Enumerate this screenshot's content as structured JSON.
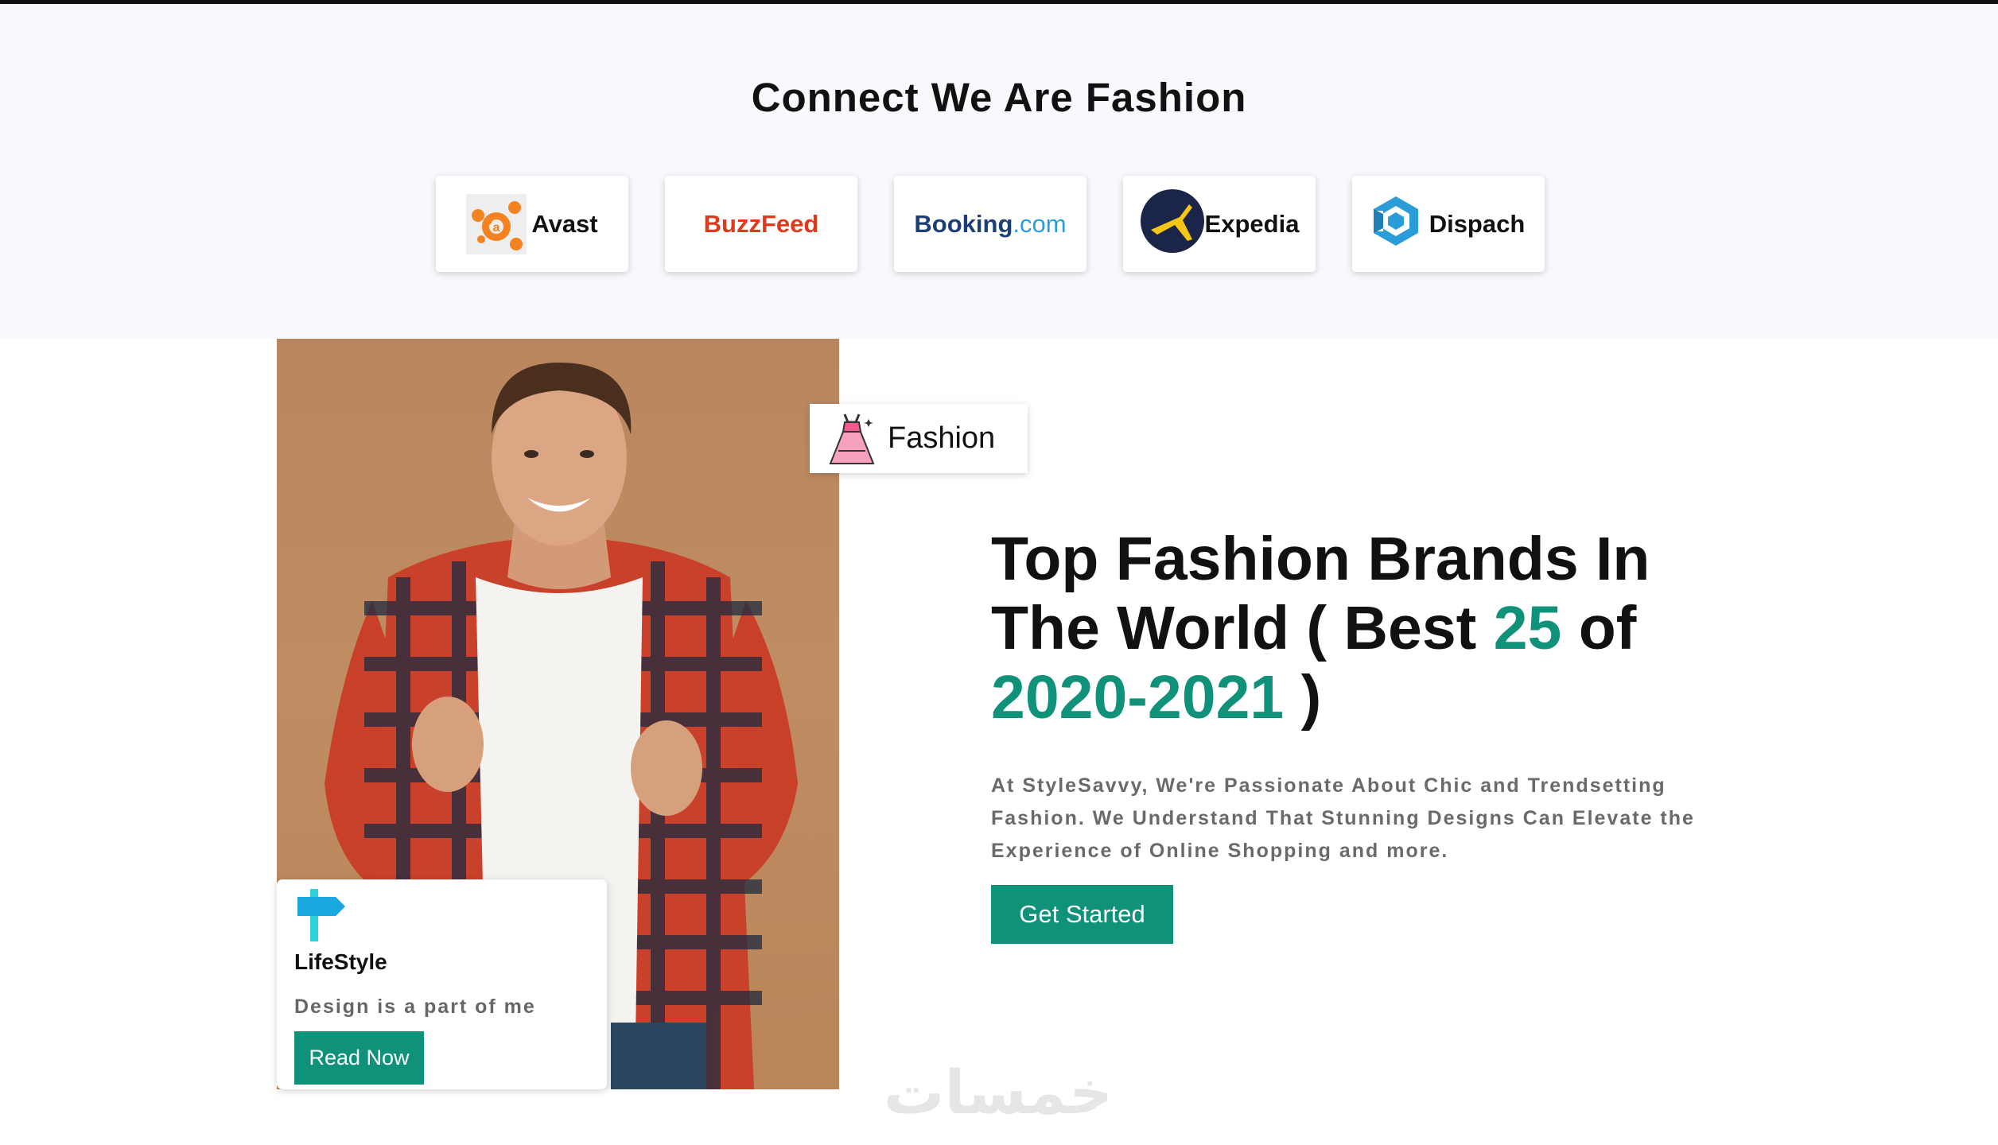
{
  "section": {
    "title": "Connect We Are Fashion"
  },
  "brands": [
    {
      "name": "Avast",
      "icon": "avast-icon"
    },
    {
      "name": "BuzzFeed",
      "icon": ""
    },
    {
      "name_a": "Booking",
      "name_b": ".com",
      "icon": ""
    },
    {
      "name": "Expedia",
      "icon": "expedia-icon"
    },
    {
      "name": "Dispach",
      "icon": "dispach-icon"
    }
  ],
  "tag": {
    "label": "Fashion",
    "icon": "dress-icon"
  },
  "lifestyle": {
    "title": "LifeStyle",
    "subtitle": "Design is a part of me",
    "button": "Read Now",
    "icon": "signpost-icon"
  },
  "hero": {
    "headline_line1": "Top Fashion Brands In",
    "headline_line2_start": "The World ( Best ",
    "headline_accent_num": "25",
    "headline_line2_end": " of",
    "headline_accent_years": "2020-2021",
    "headline_close": " )",
    "description": "At StyleSavvy, We're Passionate About Chic and Trendsetting Fashion. We Understand That Stunning Designs Can Elevate the Experience of Online Shopping and more.",
    "cta": "Get Started"
  },
  "colors": {
    "accent": "#10917a",
    "background_top": "#f8f9fc",
    "buzzfeed": "#e03a1c",
    "booking_dark": "#1c3f78",
    "booking_light": "#2a9dd8"
  },
  "watermark": "خمسات"
}
